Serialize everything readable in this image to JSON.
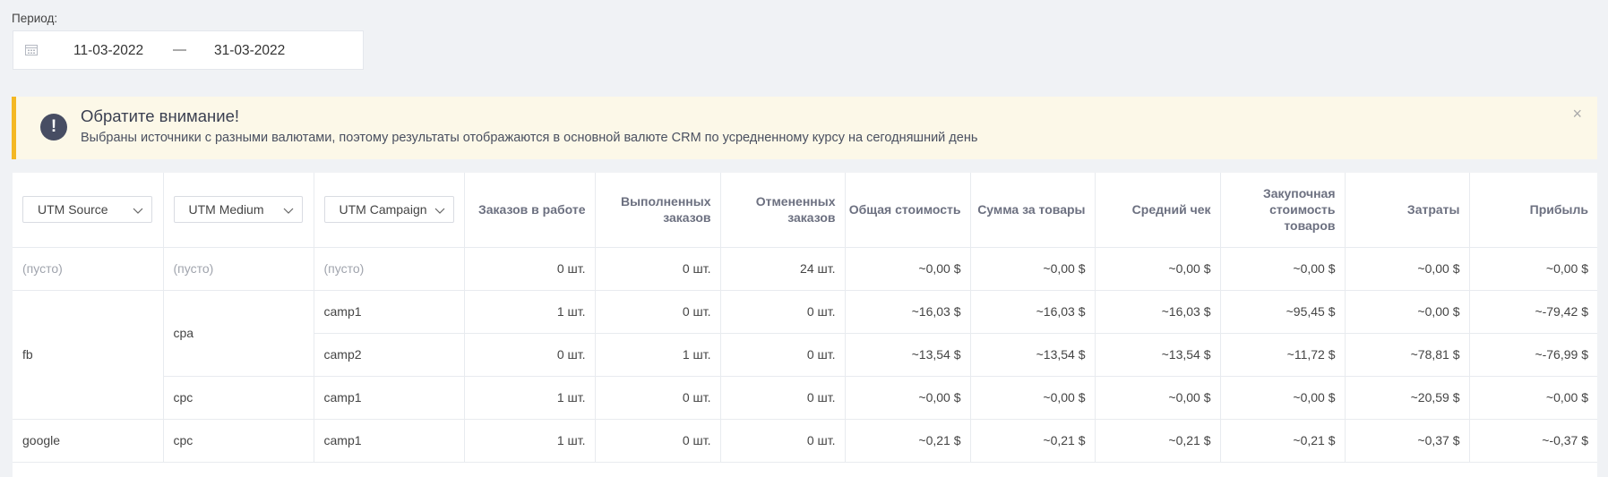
{
  "period": {
    "label": "Период:",
    "date_from": "11-03-2022",
    "separator": "—",
    "date_to": "31-03-2022"
  },
  "notice": {
    "title": "Обратите внимание!",
    "text": "Выбраны источники с разными валютами, поэтому результаты отображаются в основной валюте CRM по усредненному курсу на сегодняшний день",
    "icon": "!",
    "close": "×",
    "accent_color": "#f4b824"
  },
  "table": {
    "filters": {
      "source": "UTM Source",
      "medium": "UTM Medium",
      "campaign": "UTM Campaign"
    },
    "headers": {
      "in_work": "Заказов в работе",
      "completed": "Выполненных заказов",
      "cancelled": "Отмененных заказов",
      "total_cost": "Общая стоимость",
      "goods_sum": "Сумма за товары",
      "avg_check": "Средний чек",
      "purchase_cost": "Закупочная стоимость товаров",
      "expenses": "Затраты",
      "profit": "Прибыль"
    },
    "rows": [
      {
        "source": "(пусто)",
        "medium": "(пусто)",
        "campaign": "(пусто)",
        "in_work": "0 шт.",
        "completed": "0 шт.",
        "cancelled": "24 шт.",
        "total_cost": "~0,00 $",
        "goods_sum": "~0,00 $",
        "avg_check": "~0,00 $",
        "purchase_cost": "~0,00 $",
        "expenses": "~0,00 $",
        "profit": "~0,00 $"
      },
      {
        "source": "fb",
        "medium": "cpa",
        "campaign": "camp1",
        "in_work": "1 шт.",
        "completed": "0 шт.",
        "cancelled": "0 шт.",
        "total_cost": "~16,03 $",
        "goods_sum": "~16,03 $",
        "avg_check": "~16,03 $",
        "purchase_cost": "~95,45 $",
        "expenses": "~0,00 $",
        "profit": "~-79,42 $"
      },
      {
        "source": "",
        "medium": "",
        "campaign": "camp2",
        "in_work": "0 шт.",
        "completed": "1 шт.",
        "cancelled": "0 шт.",
        "total_cost": "~13,54 $",
        "goods_sum": "~13,54 $",
        "avg_check": "~13,54 $",
        "purchase_cost": "~11,72 $",
        "expenses": "~78,81 $",
        "profit": "~-76,99 $"
      },
      {
        "source": "",
        "medium": "cpc",
        "campaign": "camp1",
        "in_work": "1 шт.",
        "completed": "0 шт.",
        "cancelled": "0 шт.",
        "total_cost": "~0,00 $",
        "goods_sum": "~0,00 $",
        "avg_check": "~0,00 $",
        "purchase_cost": "~0,00 $",
        "expenses": "~20,59 $",
        "profit": "~0,00 $"
      },
      {
        "source": "google",
        "medium": "cpc",
        "campaign": "camp1",
        "in_work": "1 шт.",
        "completed": "0 шт.",
        "cancelled": "0 шт.",
        "total_cost": "~0,21 $",
        "goods_sum": "~0,21 $",
        "avg_check": "~0,21 $",
        "purchase_cost": "~0,21 $",
        "expenses": "~0,37 $",
        "profit": "~-0,37 $"
      }
    ]
  }
}
